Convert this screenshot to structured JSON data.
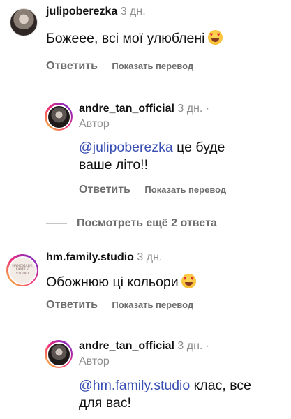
{
  "comments": [
    {
      "username": "julipoberezka",
      "time": "3 дн.",
      "text": "Божеее, всі мої улюблені",
      "emoji": "heart-eyes-emoji",
      "reply_label": "Ответить",
      "translate_label": "Показать перевод",
      "replies": [
        {
          "username": "andre_tan_official",
          "time": "3 дн. ·",
          "author_label": "Автор",
          "mention": "@julipoberezka",
          "text_line1": " це буде",
          "text_line2": "ваше літо!!",
          "reply_label": "Ответить",
          "translate_label": "Показать перевод"
        }
      ],
      "more_replies_label": "Посмотреть ещё 2 ответа"
    },
    {
      "username": "hm.family.studio",
      "time": "3 дн.",
      "text": "Обожнюю ці кольори",
      "emoji": "heart-eyes-emoji",
      "reply_label": "Ответить",
      "translate_label": "Показать перевод",
      "replies": [
        {
          "username": "andre_tan_official",
          "time": "3 дн. ·",
          "author_label": "Автор",
          "mention": "@hm.family.studio",
          "text_line1": " клас, все",
          "text_line2": "для вас!"
        }
      ]
    }
  ],
  "avatars": {
    "studio_logo_line1": "HANDMADE",
    "studio_logo_line2": "FAMILY STUDIO"
  }
}
